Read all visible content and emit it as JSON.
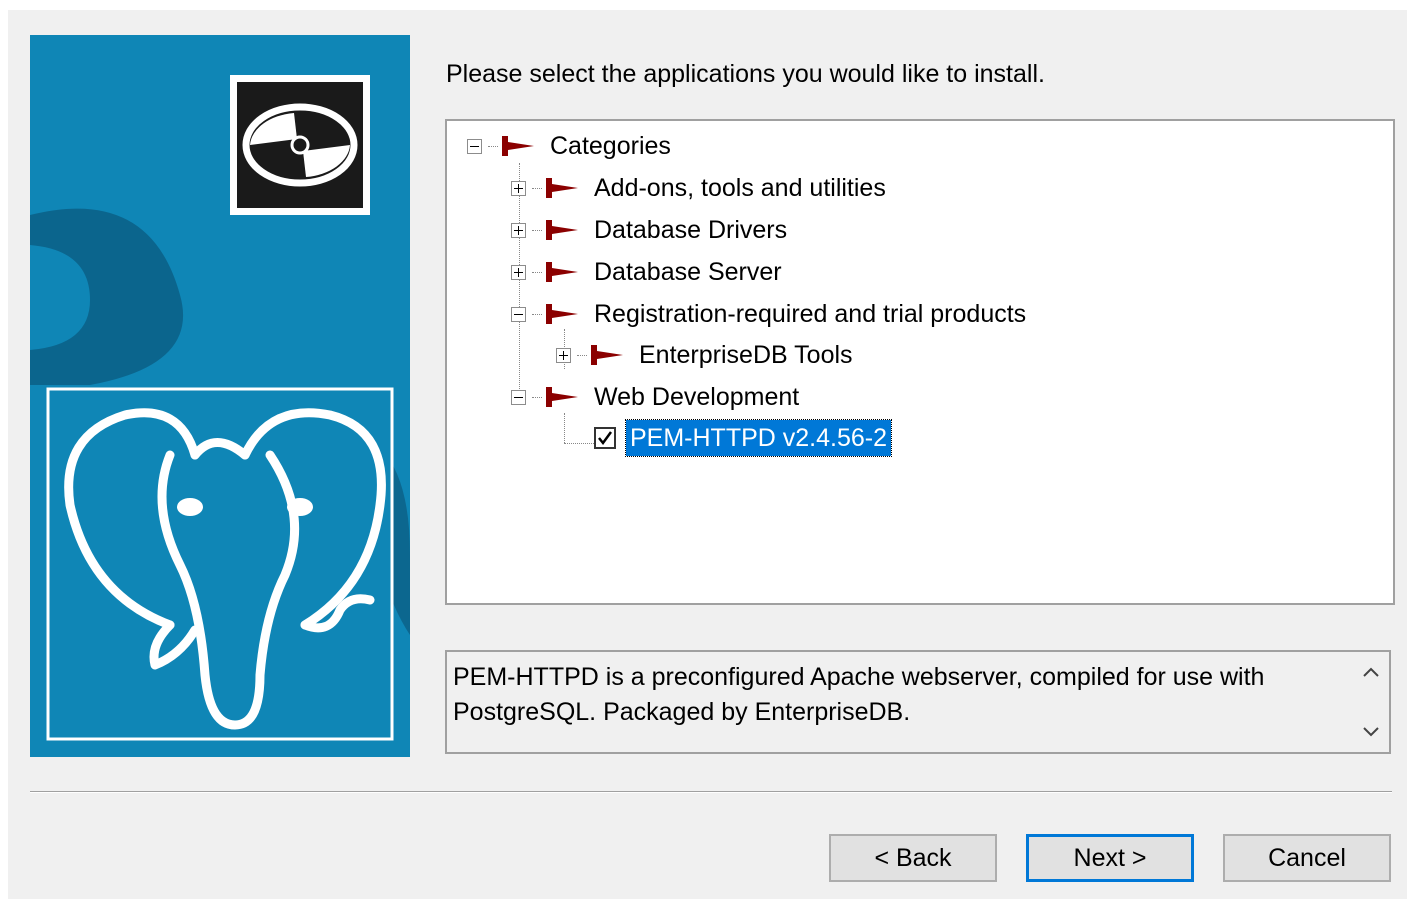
{
  "prompt": "Please select the applications you would like to install.",
  "tree": {
    "root": "Categories",
    "categories": [
      "Add-ons, tools and utilities",
      "Database Drivers",
      "Database Server",
      "Registration-required and trial products",
      "EnterpriseDB Tools",
      "Web Development"
    ],
    "application": {
      "label": "PEM-HTTPD v2.4.56-2",
      "checked": true,
      "selected": true
    }
  },
  "description": "PEM-HTTPD is a preconfigured Apache webserver, compiled for use with PostgreSQL. Packaged by EnterpriseDB.",
  "buttons": {
    "back": "< Back",
    "next": "Next >",
    "cancel": "Cancel"
  },
  "colors": {
    "banner": "#0f86b6",
    "flag": "#8b0000",
    "selection": "#0078d7",
    "default_button_border": "#0078d7"
  },
  "icons": {
    "banner_disc": "disc-icon",
    "banner_elephant": "postgresql-elephant-logo",
    "tree_node": "category-flag-icon",
    "scroll_up": "chevron-up-icon",
    "scroll_down": "chevron-down-icon"
  }
}
